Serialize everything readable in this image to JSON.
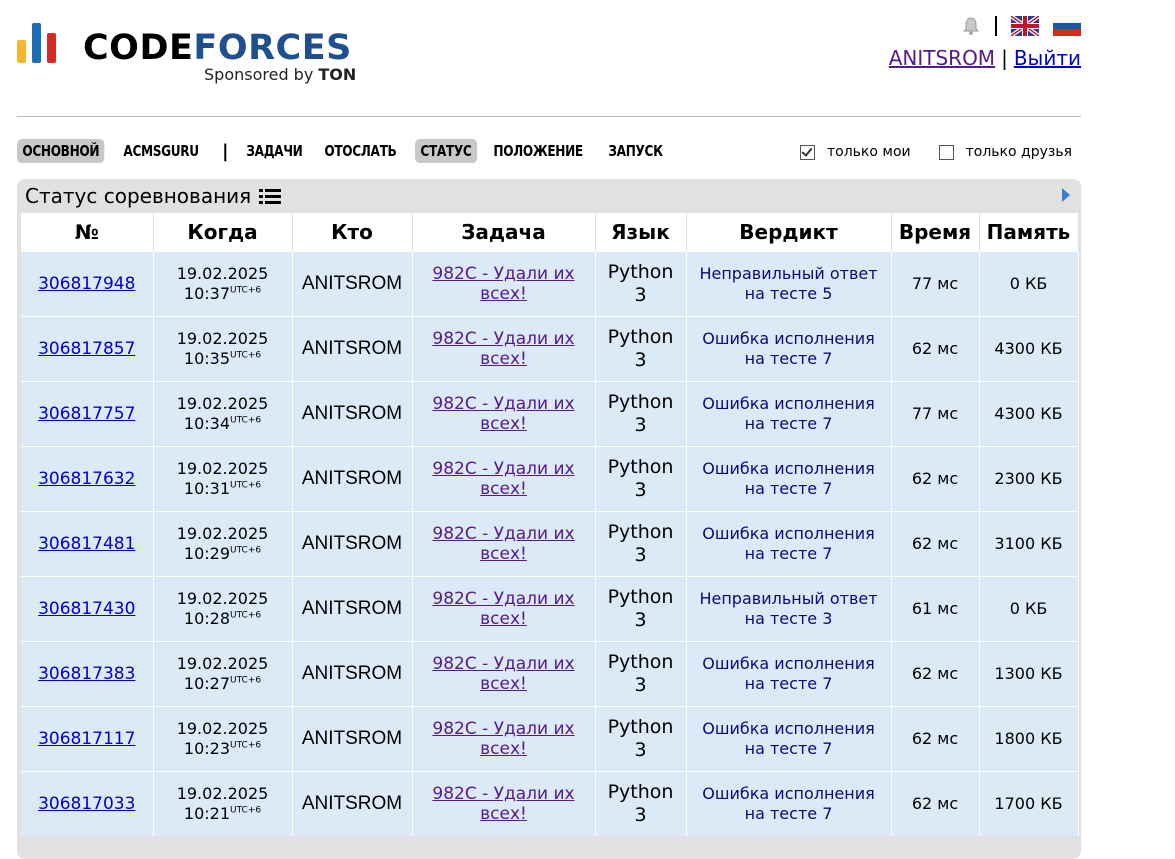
{
  "header": {
    "logo": {
      "word1": "CODE",
      "word2": "FORCES",
      "sponsor_prefix": "Sponsored by ",
      "sponsor_brand": "TON"
    },
    "logo_colors": [
      "#f2b630",
      "#1a6fb7",
      "#d62b2b"
    ],
    "user": {
      "handle": "ANITSROM",
      "separator": "|",
      "logout": "Выйти"
    },
    "lang_icons": [
      "uk-flag-icon",
      "ru-flag-icon"
    ]
  },
  "menu": {
    "items": [
      {
        "label": "ОСНОВНОЙ",
        "active": true
      },
      {
        "label": "ACMSGURU",
        "active": false
      },
      {
        "label": "ЗАДАЧИ",
        "active": false
      },
      {
        "label": "ОТОСЛАТЬ",
        "active": false
      },
      {
        "label": "СТАТУС",
        "active": true
      },
      {
        "label": "ПОЛОЖЕНИЕ",
        "active": false
      },
      {
        "label": "ЗАПУСК",
        "active": false
      }
    ],
    "separator": "|"
  },
  "filters": {
    "only_mine": {
      "label": "только мои",
      "checked": true
    },
    "only_friends": {
      "label": "только друзья",
      "checked": false
    }
  },
  "status": {
    "title": "Статус соревнования",
    "columns": [
      "№",
      "Когда",
      "Кто",
      "Задача",
      "Язык",
      "Вердикт",
      "Время",
      "Память"
    ],
    "rows": [
      {
        "id": "306817948",
        "date": "19.02.2025",
        "time": "10:37",
        "tz": "UTC+6",
        "who": "ANITSROM",
        "problem1": "982C - Удали их",
        "problem2": "всех!",
        "lang1": "Python",
        "lang2": "3",
        "verdict1": "Неправильный ответ",
        "verdict2": "на тесте 5",
        "exec": "77 мс",
        "mem": "0 КБ"
      },
      {
        "id": "306817857",
        "date": "19.02.2025",
        "time": "10:35",
        "tz": "UTC+6",
        "who": "ANITSROM",
        "problem1": "982C - Удали их",
        "problem2": "всех!",
        "lang1": "Python",
        "lang2": "3",
        "verdict1": "Ошибка исполнения",
        "verdict2": "на тесте 7",
        "exec": "62 мс",
        "mem": "4300 КБ"
      },
      {
        "id": "306817757",
        "date": "19.02.2025",
        "time": "10:34",
        "tz": "UTC+6",
        "who": "ANITSROM",
        "problem1": "982C - Удали их",
        "problem2": "всех!",
        "lang1": "Python",
        "lang2": "3",
        "verdict1": "Ошибка исполнения",
        "verdict2": "на тесте 7",
        "exec": "77 мс",
        "mem": "4300 КБ"
      },
      {
        "id": "306817632",
        "date": "19.02.2025",
        "time": "10:31",
        "tz": "UTC+6",
        "who": "ANITSROM",
        "problem1": "982C - Удали их",
        "problem2": "всех!",
        "lang1": "Python",
        "lang2": "3",
        "verdict1": "Ошибка исполнения",
        "verdict2": "на тесте 7",
        "exec": "62 мс",
        "mem": "2300 КБ"
      },
      {
        "id": "306817481",
        "date": "19.02.2025",
        "time": "10:29",
        "tz": "UTC+6",
        "who": "ANITSROM",
        "problem1": "982C - Удали их",
        "problem2": "всех!",
        "lang1": "Python",
        "lang2": "3",
        "verdict1": "Ошибка исполнения",
        "verdict2": "на тесте 7",
        "exec": "62 мс",
        "mem": "3100 КБ"
      },
      {
        "id": "306817430",
        "date": "19.02.2025",
        "time": "10:28",
        "tz": "UTC+6",
        "who": "ANITSROM",
        "problem1": "982C - Удали их",
        "problem2": "всех!",
        "lang1": "Python",
        "lang2": "3",
        "verdict1": "Неправильный ответ",
        "verdict2": "на тесте 3",
        "exec": "61 мс",
        "mem": "0 КБ"
      },
      {
        "id": "306817383",
        "date": "19.02.2025",
        "time": "10:27",
        "tz": "UTC+6",
        "who": "ANITSROM",
        "problem1": "982C - Удали их",
        "problem2": "всех!",
        "lang1": "Python",
        "lang2": "3",
        "verdict1": "Ошибка исполнения",
        "verdict2": "на тесте 7",
        "exec": "62 мс",
        "mem": "1300 КБ"
      },
      {
        "id": "306817117",
        "date": "19.02.2025",
        "time": "10:23",
        "tz": "UTC+6",
        "who": "ANITSROM",
        "problem1": "982C - Удали их",
        "problem2": "всех!",
        "lang1": "Python",
        "lang2": "3",
        "verdict1": "Ошибка исполнения",
        "verdict2": "на тесте 7",
        "exec": "62 мс",
        "mem": "1800 КБ"
      },
      {
        "id": "306817033",
        "date": "19.02.2025",
        "time": "10:21",
        "tz": "UTC+6",
        "who": "ANITSROM",
        "problem1": "982C - Удали их",
        "problem2": "всех!",
        "lang1": "Python",
        "lang2": "3",
        "verdict1": "Ошибка исполнения",
        "verdict2": "на тесте 7",
        "exec": "62 мс",
        "mem": "1700 КБ"
      }
    ]
  }
}
